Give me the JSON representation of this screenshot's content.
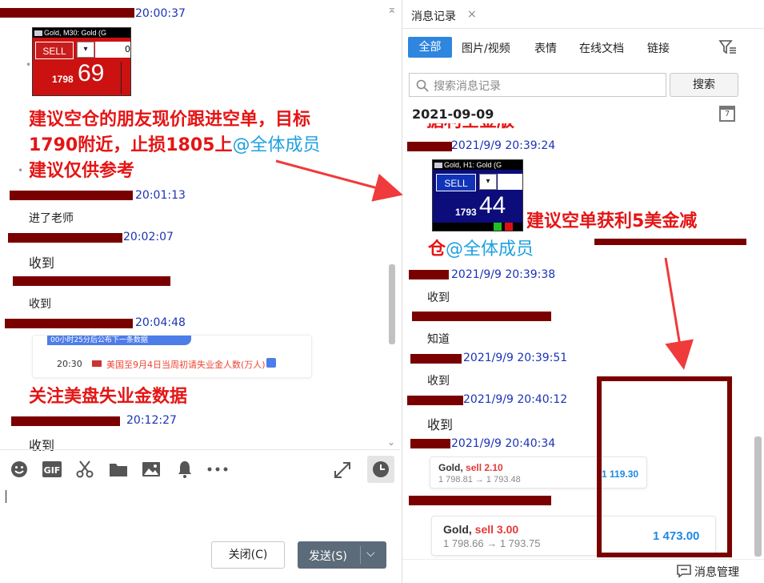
{
  "left": {
    "messages": [
      {
        "time": "20:00:37"
      },
      {
        "time": "20:01:13",
        "text": "进了老师"
      },
      {
        "time": "20:02:07",
        "text": "收到"
      },
      {
        "text": "收到"
      },
      {
        "time": "20:04:48"
      },
      {
        "time": "20:12:27",
        "text": "收到"
      }
    ],
    "card1": {
      "header": "Gold, M30: Gold (G",
      "sell": "SELL",
      "price_small": "1798",
      "price_big": "69",
      "field": "0"
    },
    "annotation1_line1": "建议空仓的朋友现价跟进空单，目标",
    "annotation1_line2": "1790附近，止损1805上",
    "annotation1_at": "@全体成员",
    "annotation1_line3": "建议仅供参考",
    "calendar_card": {
      "banner": "00小时25分后公布下一条数据",
      "time": "20:30",
      "title": "美国至9月4日当周初请失业金人数(万人)"
    },
    "annotation2": "关注美盘失业金数据",
    "close_button": "关闭(C)",
    "send_button": "发送(S)"
  },
  "right": {
    "window_tab": "消息记录",
    "filters": [
      "全部",
      "图片/视频",
      "表情",
      "在线文档",
      "链接"
    ],
    "search_placeholder": "搜索消息记录",
    "search_button": "搜索",
    "date": "2021-09-09",
    "date_icon_day": "7",
    "partial_top": "据利空金版",
    "messages": [
      {
        "time": "2021/9/9 20:39:24"
      },
      {
        "time": "2021/9/9 20:39:38",
        "text": "收到"
      },
      {
        "text": "知道"
      },
      {
        "time": "2021/9/9 20:39:51",
        "text": "收到"
      },
      {
        "time": "2021/9/9 20:40:12",
        "text": "收到"
      },
      {
        "time": "2021/9/9 20:40:34"
      }
    ],
    "card2": {
      "header": "Gold, H1: Gold (G",
      "sell": "SELL",
      "price_small": "1793",
      "price_big": "44"
    },
    "annotation3_line1": "建议空单获利5美金减",
    "annotation3_line2": "仓",
    "annotation3_at": "@全体成员",
    "trade1": {
      "symbol": "Gold,",
      "side": "sell 2.10",
      "prices": "1 798.81 → 1 793.48",
      "profit": "1 119.30"
    },
    "trade2": {
      "symbol": "Gold,",
      "side": "sell 3.00",
      "prices": "1 798.66 → 1 793.75",
      "profit": "1 473.00"
    },
    "footer": "消息管理"
  },
  "colors": {
    "annotation_red": "#e51515",
    "at_blue": "#1ea0e0",
    "timestamp_blue": "#1b33b5",
    "redact": "#7a0000",
    "arrow": "#ef3b3b",
    "tab_active": "#2e86de"
  }
}
